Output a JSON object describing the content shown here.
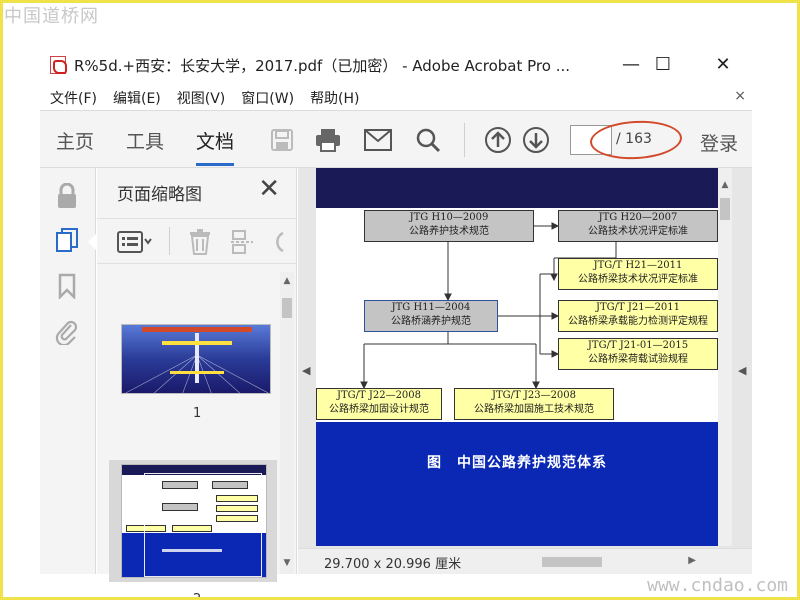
{
  "watermark": {
    "top": "中国道桥网",
    "bottom": "www.cndao.com"
  },
  "window": {
    "title": "R%5d.+西安：长安大学，2017.pdf（已加密） - Adobe Acrobat Pro ...",
    "controls": {
      "minimize": "—",
      "maximize": "☐",
      "close": "✕"
    }
  },
  "menu": {
    "items": [
      "文件(F)",
      "编辑(E)",
      "视图(V)",
      "窗口(W)",
      "帮助(H)"
    ],
    "close": "×"
  },
  "toolbar": {
    "tabs": [
      "主页",
      "工具",
      "文档"
    ],
    "active_tab": "文档",
    "page_current": "",
    "page_total": "/ 163",
    "login": "登录"
  },
  "panel": {
    "title": "页面缩略图",
    "close": "✕",
    "thumbnails": [
      {
        "label": "1"
      },
      {
        "label": "2"
      }
    ]
  },
  "document": {
    "boxes": {
      "h10": "JTG H10—2009\n公路养护技术规范",
      "h20": "JTG H20—2007\n公路技术状况评定标准",
      "h21": "JTG/T H21—2011\n公路桥梁技术状况评定标准",
      "h11": "JTG H11—2004\n公路桥涵养护规范",
      "j21": "JTG/T J21—2011\n公路桥梁承载能力检测评定规程",
      "j2101": "JTG/T J21-01—2015\n公路桥梁荷载试验规程",
      "j22": "JTG/T J22—2008\n公路桥梁加固设计规范",
      "j23": "JTG/T J23—2008\n公路桥梁加固施工技术规范"
    },
    "caption": "图　中国公路养护规范体系",
    "dimensions": "29.700 x 20.996 厘米"
  }
}
